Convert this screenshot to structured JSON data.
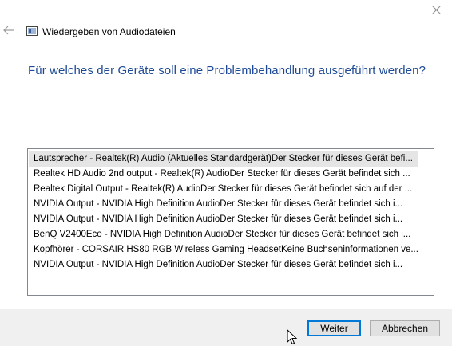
{
  "window": {
    "title": "Wiedergeben von Audiodateien",
    "close_icon": "close-icon",
    "back_icon": "back-arrow-icon"
  },
  "headline": "Für welches der Geräte soll eine Problembehandlung ausgeführt werden?",
  "devices": [
    "Lautsprecher - Realtek(R) Audio (Aktuelles Standardgerät)Der Stecker für dieses Gerät befi...",
    "Realtek HD Audio 2nd output - Realtek(R) AudioDer Stecker für dieses Gerät befindet sich ...",
    "Realtek Digital Output - Realtek(R) AudioDer Stecker für dieses Gerät befindet sich auf der ...",
    "NVIDIA Output - NVIDIA High Definition AudioDer Stecker für dieses Gerät befindet sich i...",
    "NVIDIA Output - NVIDIA High Definition AudioDer Stecker für dieses Gerät befindet sich i...",
    "BenQ V2400Eco - NVIDIA High Definition AudioDer Stecker für dieses Gerät befindet sich i...",
    "Kopfhörer - CORSAIR HS80 RGB Wireless Gaming HeadsetKeine Buchseninformationen ve...",
    "NVIDIA Output - NVIDIA High Definition AudioDer Stecker für dieses Gerät befindet sich i..."
  ],
  "selected_index": 0,
  "buttons": {
    "next": "Weiter",
    "cancel": "Abbrechen"
  },
  "colors": {
    "headline": "#1e4a95",
    "selection": "#e5e5e5",
    "default_button_border": "#0078d7"
  }
}
